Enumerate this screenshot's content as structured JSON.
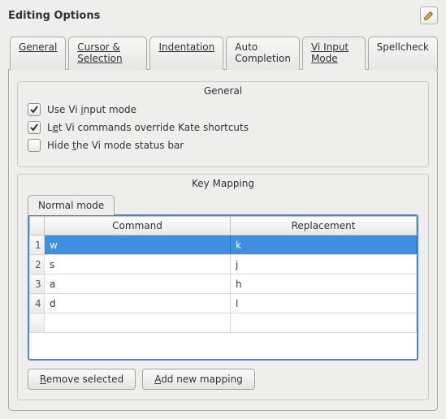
{
  "title": "Editing Options",
  "tabs": {
    "general": "General",
    "cursor": "Cursor & Selection",
    "indent": "Indentation",
    "auto": "Auto Completion",
    "vi": "Vi Input Mode",
    "spell": "Spellcheck"
  },
  "group_general": {
    "title": "General",
    "use_vi": "Use Vi input mode",
    "override": "Let Vi commands override Kate shortcuts",
    "hide_status": "Hide the Vi mode status bar"
  },
  "group_keymap": {
    "title": "Key Mapping",
    "tab_normal": "Normal mode",
    "col_command": "Command",
    "col_replacement": "Replacement",
    "rows": [
      {
        "n": "1",
        "cmd": "w",
        "rep": "k"
      },
      {
        "n": "2",
        "cmd": "s",
        "rep": "j"
      },
      {
        "n": "3",
        "cmd": "a",
        "rep": "h"
      },
      {
        "n": "4",
        "cmd": "d",
        "rep": "l"
      }
    ]
  },
  "buttons": {
    "remove": "Remove selected",
    "add": "Add new mapping"
  }
}
